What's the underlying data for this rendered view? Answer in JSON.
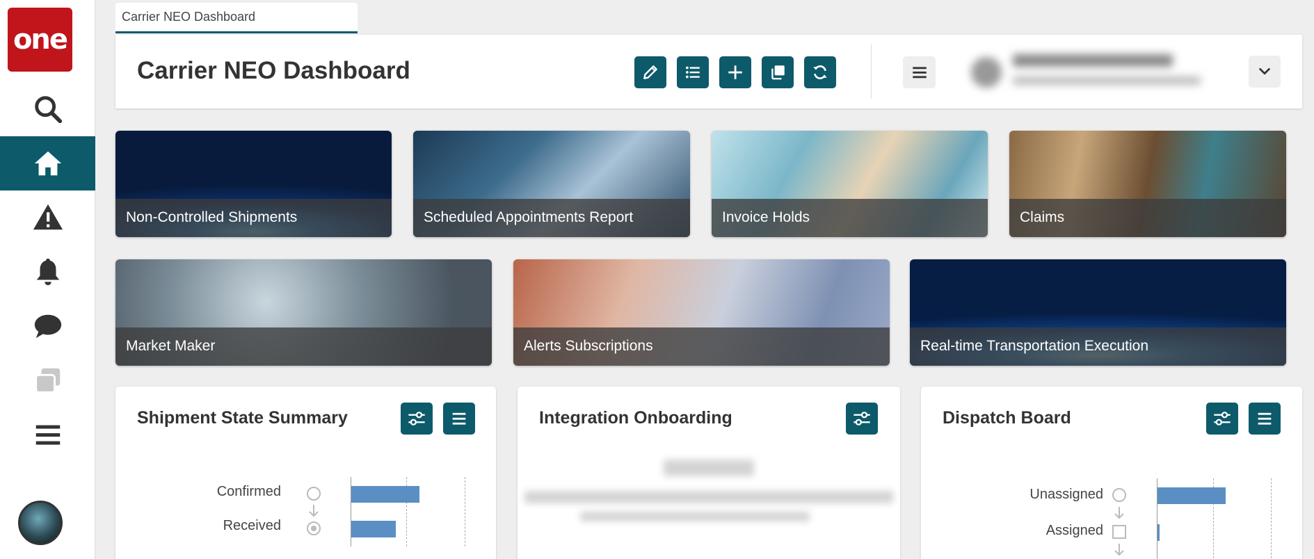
{
  "app": {
    "logo_text": "one"
  },
  "sidebar": {
    "items": [
      {
        "name": "search",
        "icon": "search-icon"
      },
      {
        "name": "home",
        "icon": "home-icon",
        "active": true
      },
      {
        "name": "alerts",
        "icon": "warning-icon"
      },
      {
        "name": "notifications",
        "icon": "bell-icon"
      },
      {
        "name": "messages",
        "icon": "chat-icon"
      },
      {
        "name": "windows",
        "icon": "windows-icon"
      },
      {
        "name": "menu",
        "icon": "hamburger-icon"
      }
    ]
  },
  "tab": {
    "label": "Carrier NEO Dashboard"
  },
  "header": {
    "title": "Carrier NEO Dashboard",
    "tools": [
      "pencil-icon",
      "list-icon",
      "plus-icon",
      "copy-icon",
      "refresh-icon"
    ],
    "accent_color": "#0d5a6b"
  },
  "tiles": [
    {
      "label": "Non-Controlled Shipments"
    },
    {
      "label": "Scheduled Appointments Report"
    },
    {
      "label": "Invoice Holds"
    },
    {
      "label": "Claims"
    },
    {
      "label": "Market Maker"
    },
    {
      "label": "Alerts Subscriptions"
    },
    {
      "label": "Real-time Transportation Execution"
    }
  ],
  "widgets": {
    "shipment_state": {
      "title": "Shipment State Summary",
      "rows": [
        {
          "label": "Confirmed",
          "icon": "circle-icon"
        },
        {
          "label": "Received",
          "icon": "radio-dot-icon"
        }
      ]
    },
    "integration": {
      "title": "Integration Onboarding"
    },
    "dispatch": {
      "title": "Dispatch Board",
      "rows": [
        {
          "label": "Unassigned",
          "icon": "circle-icon"
        },
        {
          "label": "Assigned",
          "icon": "square-icon"
        }
      ]
    }
  },
  "chart_data": [
    {
      "type": "bar",
      "categories": [
        "Confirmed",
        "Received"
      ],
      "values": [
        0.6,
        0.39
      ],
      "title": "",
      "xlabel": "",
      "ylabel": ""
    },
    {
      "type": "bar",
      "categories": [
        "Unassigned",
        "Assigned"
      ],
      "values": [
        0.6,
        0.02
      ],
      "title": "",
      "xlabel": "",
      "ylabel": ""
    }
  ]
}
